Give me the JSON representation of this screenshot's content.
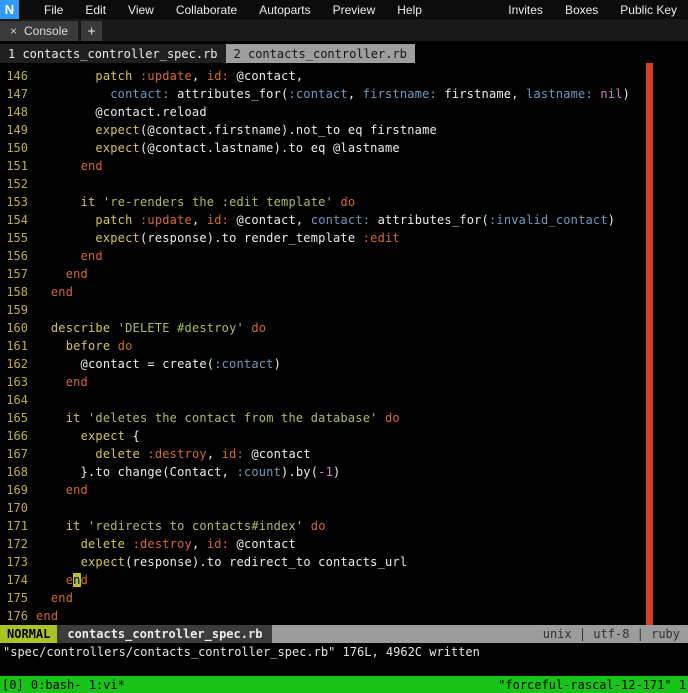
{
  "colors": {
    "logo_blue": "#2f9bf4",
    "color_column": "#d9401f",
    "mode_badge": "#a9c525",
    "cursor_block": "#b8c234",
    "tmux_green": "#17c417"
  },
  "menubar": {
    "logo": "N",
    "items": [
      "File",
      "Edit",
      "View",
      "Collaborate",
      "Autoparts",
      "Preview",
      "Help"
    ],
    "right_items": [
      "Invites",
      "Boxes",
      "Public Key"
    ]
  },
  "console_bar": {
    "close": "×",
    "tab_label": "Console",
    "add_label": "+"
  },
  "vim_tabs": [
    {
      "label": "1 contacts_controller_spec.rb",
      "active": true
    },
    {
      "label": "2 contacts_controller.rb",
      "active": false
    }
  ],
  "editor": {
    "lines": [
      {
        "num": "146",
        "tokens": [
          [
            "w",
            "        "
          ],
          [
            "y",
            "patch"
          ],
          [
            "w",
            " "
          ],
          [
            "o",
            ":update"
          ],
          [
            "w",
            ", "
          ],
          [
            "o",
            "id:"
          ],
          [
            "w",
            " @contact,"
          ]
        ]
      },
      {
        "num": "147",
        "tokens": [
          [
            "w",
            "          "
          ],
          [
            "b",
            "contact:"
          ],
          [
            "w",
            " attributes_for("
          ],
          [
            "b",
            ":contact"
          ],
          [
            "w",
            ", "
          ],
          [
            "b",
            "firstname:"
          ],
          [
            "w",
            " firstname, "
          ],
          [
            "b",
            "lastname:"
          ],
          [
            "w",
            " "
          ],
          [
            "m",
            "nil"
          ],
          [
            "w",
            ")"
          ]
        ]
      },
      {
        "num": "148",
        "tokens": [
          [
            "w",
            "        @contact.reload"
          ]
        ]
      },
      {
        "num": "149",
        "tokens": [
          [
            "w",
            "        "
          ],
          [
            "y",
            "expect"
          ],
          [
            "w",
            "(@contact.firstname).not_to eq firstname"
          ]
        ]
      },
      {
        "num": "150",
        "tokens": [
          [
            "w",
            "        "
          ],
          [
            "y",
            "expect"
          ],
          [
            "w",
            "(@contact.lastname).to eq @lastname"
          ]
        ]
      },
      {
        "num": "151",
        "tokens": [
          [
            "w",
            "      "
          ],
          [
            "o",
            "end"
          ]
        ]
      },
      {
        "num": "152",
        "tokens": []
      },
      {
        "num": "153",
        "tokens": [
          [
            "w",
            "      "
          ],
          [
            "y",
            "it"
          ],
          [
            "w",
            " "
          ],
          [
            "g",
            "'re-renders the :edit template'"
          ],
          [
            "w",
            " "
          ],
          [
            "o",
            "do"
          ]
        ]
      },
      {
        "num": "154",
        "tokens": [
          [
            "w",
            "        "
          ],
          [
            "y",
            "patch"
          ],
          [
            "w",
            " "
          ],
          [
            "o",
            ":update"
          ],
          [
            "w",
            ", "
          ],
          [
            "o",
            "id:"
          ],
          [
            "w",
            " @contact, "
          ],
          [
            "b",
            "contact:"
          ],
          [
            "w",
            " attributes_for("
          ],
          [
            "b",
            ":invalid_contact"
          ],
          [
            "w",
            ")"
          ]
        ]
      },
      {
        "num": "155",
        "tokens": [
          [
            "w",
            "        "
          ],
          [
            "y",
            "expect"
          ],
          [
            "w",
            "(response).to render_template "
          ],
          [
            "o",
            ":edit"
          ]
        ]
      },
      {
        "num": "156",
        "tokens": [
          [
            "w",
            "      "
          ],
          [
            "o",
            "end"
          ]
        ]
      },
      {
        "num": "157",
        "tokens": [
          [
            "w",
            "    "
          ],
          [
            "o",
            "end"
          ]
        ]
      },
      {
        "num": "158",
        "tokens": [
          [
            "w",
            "  "
          ],
          [
            "o",
            "end"
          ]
        ]
      },
      {
        "num": "159",
        "tokens": []
      },
      {
        "num": "160",
        "tokens": [
          [
            "w",
            "  "
          ],
          [
            "y",
            "describe"
          ],
          [
            "w",
            " "
          ],
          [
            "g",
            "'DELETE #destroy'"
          ],
          [
            "w",
            " "
          ],
          [
            "o",
            "do"
          ]
        ]
      },
      {
        "num": "161",
        "tokens": [
          [
            "w",
            "    "
          ],
          [
            "y",
            "before"
          ],
          [
            "w",
            " "
          ],
          [
            "o",
            "do"
          ]
        ]
      },
      {
        "num": "162",
        "tokens": [
          [
            "w",
            "      @contact = create("
          ],
          [
            "b",
            ":contact"
          ],
          [
            "w",
            ")"
          ]
        ]
      },
      {
        "num": "163",
        "tokens": [
          [
            "w",
            "    "
          ],
          [
            "o",
            "end"
          ]
        ]
      },
      {
        "num": "164",
        "tokens": []
      },
      {
        "num": "165",
        "tokens": [
          [
            "w",
            "    "
          ],
          [
            "y",
            "it"
          ],
          [
            "w",
            " "
          ],
          [
            "g",
            "'deletes the contact from the database'"
          ],
          [
            "w",
            " "
          ],
          [
            "o",
            "do"
          ]
        ]
      },
      {
        "num": "166",
        "tokens": [
          [
            "w",
            "      "
          ],
          [
            "y",
            "expect"
          ],
          [
            "w",
            " {"
          ]
        ]
      },
      {
        "num": "167",
        "tokens": [
          [
            "w",
            "        "
          ],
          [
            "y",
            "delete"
          ],
          [
            "w",
            " "
          ],
          [
            "o",
            ":destroy"
          ],
          [
            "w",
            ", "
          ],
          [
            "o",
            "id:"
          ],
          [
            "w",
            " @contact"
          ]
        ]
      },
      {
        "num": "168",
        "tokens": [
          [
            "w",
            "      }.to change(Contact, "
          ],
          [
            "b",
            ":count"
          ],
          [
            "w",
            ").by("
          ],
          [
            "m",
            "-1"
          ],
          [
            "w",
            ")"
          ]
        ]
      },
      {
        "num": "169",
        "tokens": [
          [
            "w",
            "    "
          ],
          [
            "o",
            "end"
          ]
        ]
      },
      {
        "num": "170",
        "tokens": []
      },
      {
        "num": "171",
        "tokens": [
          [
            "w",
            "    "
          ],
          [
            "y",
            "it"
          ],
          [
            "w",
            " "
          ],
          [
            "g",
            "'redirects to contacts#index'"
          ],
          [
            "w",
            " "
          ],
          [
            "o",
            "do"
          ]
        ]
      },
      {
        "num": "172",
        "tokens": [
          [
            "w",
            "      "
          ],
          [
            "y",
            "delete"
          ],
          [
            "w",
            " "
          ],
          [
            "o",
            ":destroy"
          ],
          [
            "w",
            ", "
          ],
          [
            "o",
            "id:"
          ],
          [
            "w",
            " @contact"
          ]
        ]
      },
      {
        "num": "173",
        "tokens": [
          [
            "w",
            "      "
          ],
          [
            "y",
            "expect"
          ],
          [
            "w",
            "(response).to redirect_to contacts_url"
          ]
        ]
      },
      {
        "num": "174",
        "tokens": [
          [
            "w",
            "    "
          ],
          [
            "o",
            "e"
          ],
          [
            "cur",
            "n"
          ],
          [
            "o",
            "d"
          ]
        ]
      },
      {
        "num": "175",
        "tokens": [
          [
            "w",
            "  "
          ],
          [
            "o",
            "end"
          ]
        ]
      },
      {
        "num": "176",
        "tokens": [
          [
            "o",
            "end"
          ]
        ]
      }
    ]
  },
  "statusline": {
    "mode": "NORMAL",
    "filename": "contacts_controller_spec.rb",
    "right": "unix | utf-8 | ruby"
  },
  "cmdline": "\"spec/controllers/contacts_controller_spec.rb\" 176L, 4962C written",
  "tmux": {
    "left": "[0] 0:bash- 1:vi*",
    "right": "\"forceful-rascal-12-171\" 1"
  }
}
